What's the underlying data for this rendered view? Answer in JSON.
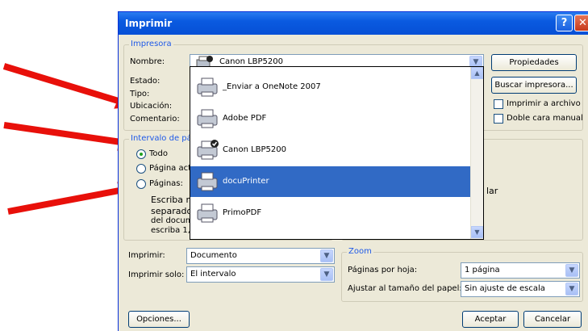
{
  "window": {
    "title": "Imprimir",
    "help_glyph": "?",
    "close_glyph": "✕"
  },
  "printer": {
    "group_label": "Impresora",
    "nombre_label": "Nombre:",
    "selected": "Canon LBP5200",
    "properties_button": "Propiedades",
    "estado_label": "Estado:",
    "tipo_label": "Tipo:",
    "ubicacion_label": "Ubicación:",
    "comentario_label": "Comentario:",
    "find_button": "Buscar impresora...",
    "print_to_file": "Imprimir a archivo",
    "duplex": "Doble cara manual"
  },
  "dropdown": {
    "items": [
      {
        "name": "_Enviar a OneNote 2007",
        "selected": false,
        "default": false
      },
      {
        "name": "Adobe PDF",
        "selected": false,
        "default": false
      },
      {
        "name": "Canon LBP5200",
        "selected": false,
        "default": true
      },
      {
        "name": "docuPrinter",
        "selected": true,
        "default": false
      },
      {
        "name": "PrimoPDF",
        "selected": false,
        "default": false
      }
    ]
  },
  "range": {
    "group_label": "Intervalo de pá",
    "todo": "Todo",
    "pagina_actual": "Página act",
    "paginas": "Páginas:",
    "help_line1": "Escriba nú",
    "help_line2": "separados",
    "help_line3": "del docume",
    "help_line4": "escriba 1, 3, 5-12 o p1s1, p1s2, p1s3-p8s3",
    "partial_right": "lar"
  },
  "print_what": {
    "label": "Imprimir:",
    "value": "Documento"
  },
  "print_only": {
    "label": "Imprimir solo:",
    "value": "El intervalo"
  },
  "zoom": {
    "group_label": "Zoom",
    "pages_label": "Páginas por hoja:",
    "pages_value": "1 página",
    "scale_label": "Ajustar al tamaño del papel:",
    "scale_value": "Sin ajuste de escala"
  },
  "footer": {
    "options": "Opciones...",
    "accept": "Aceptar",
    "cancel": "Cancelar"
  },
  "annotation": {
    "arrow_color": "#e8100a",
    "arrow_count": 4
  },
  "icons": {
    "scroll_up": "▲",
    "scroll_down": "▼",
    "combo_arrow": "▼"
  }
}
